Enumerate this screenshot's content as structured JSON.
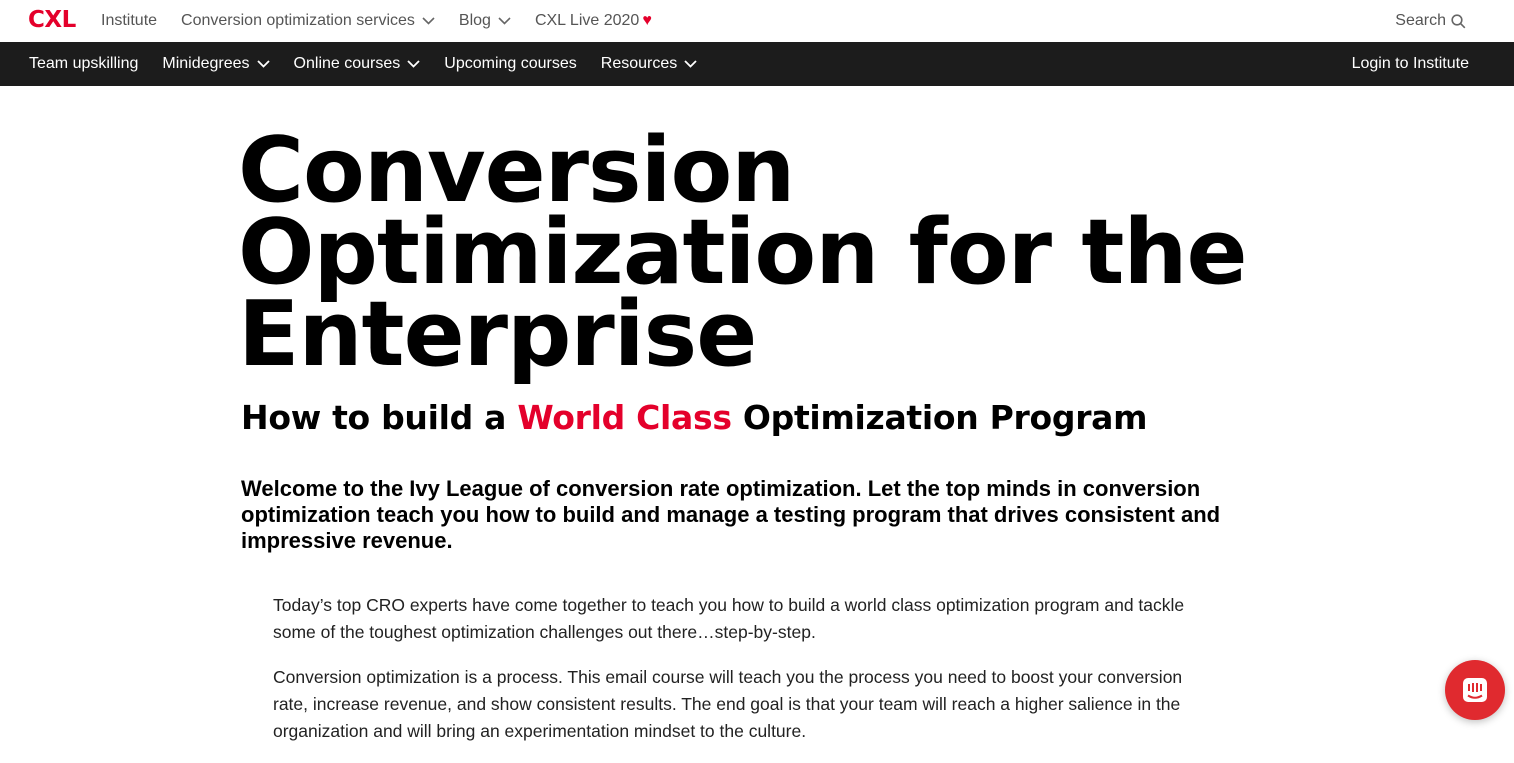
{
  "brand": {
    "logo_text": "CXL",
    "accent_color": "#e4002b"
  },
  "top_nav": {
    "items": [
      {
        "label": "Institute"
      },
      {
        "label": "Conversion optimization services"
      },
      {
        "label": "Blog"
      },
      {
        "label": "CXL Live 2020"
      }
    ],
    "search_label": "Search"
  },
  "main_nav": {
    "items": [
      {
        "label": "Team upskilling"
      },
      {
        "label": "Minidegrees"
      },
      {
        "label": "Online courses"
      },
      {
        "label": "Upcoming courses"
      },
      {
        "label": "Resources"
      }
    ],
    "login_label": "Login to Institute"
  },
  "hero": {
    "title_lines": [
      "Conversion",
      "Optimization for the",
      "Enterprise"
    ],
    "subtitle_before": "How to build a ",
    "subtitle_accent": "World Class",
    "subtitle_after": " Optimization Program",
    "lead": "Welcome to the Ivy League of conversion rate optimization. Let the top minds in conversion optimization teach you how to build and manage a testing program that drives consistent and impressive revenue."
  },
  "body": {
    "paragraphs": [
      "Today’s top CRO experts have come together to teach you how to build a world class optimization program and tackle some of the toughest optimization challenges out there…step-by-step.",
      "Conversion optimization is a process. This email course will teach you the process you need to boost your conversion rate, increase revenue, and show consistent results. The end goal is that your team will reach a higher salience in the organization and will bring an experimentation mindset to the culture."
    ]
  },
  "chat": {
    "icon": "chat-icon",
    "color": "#e02a2f"
  }
}
